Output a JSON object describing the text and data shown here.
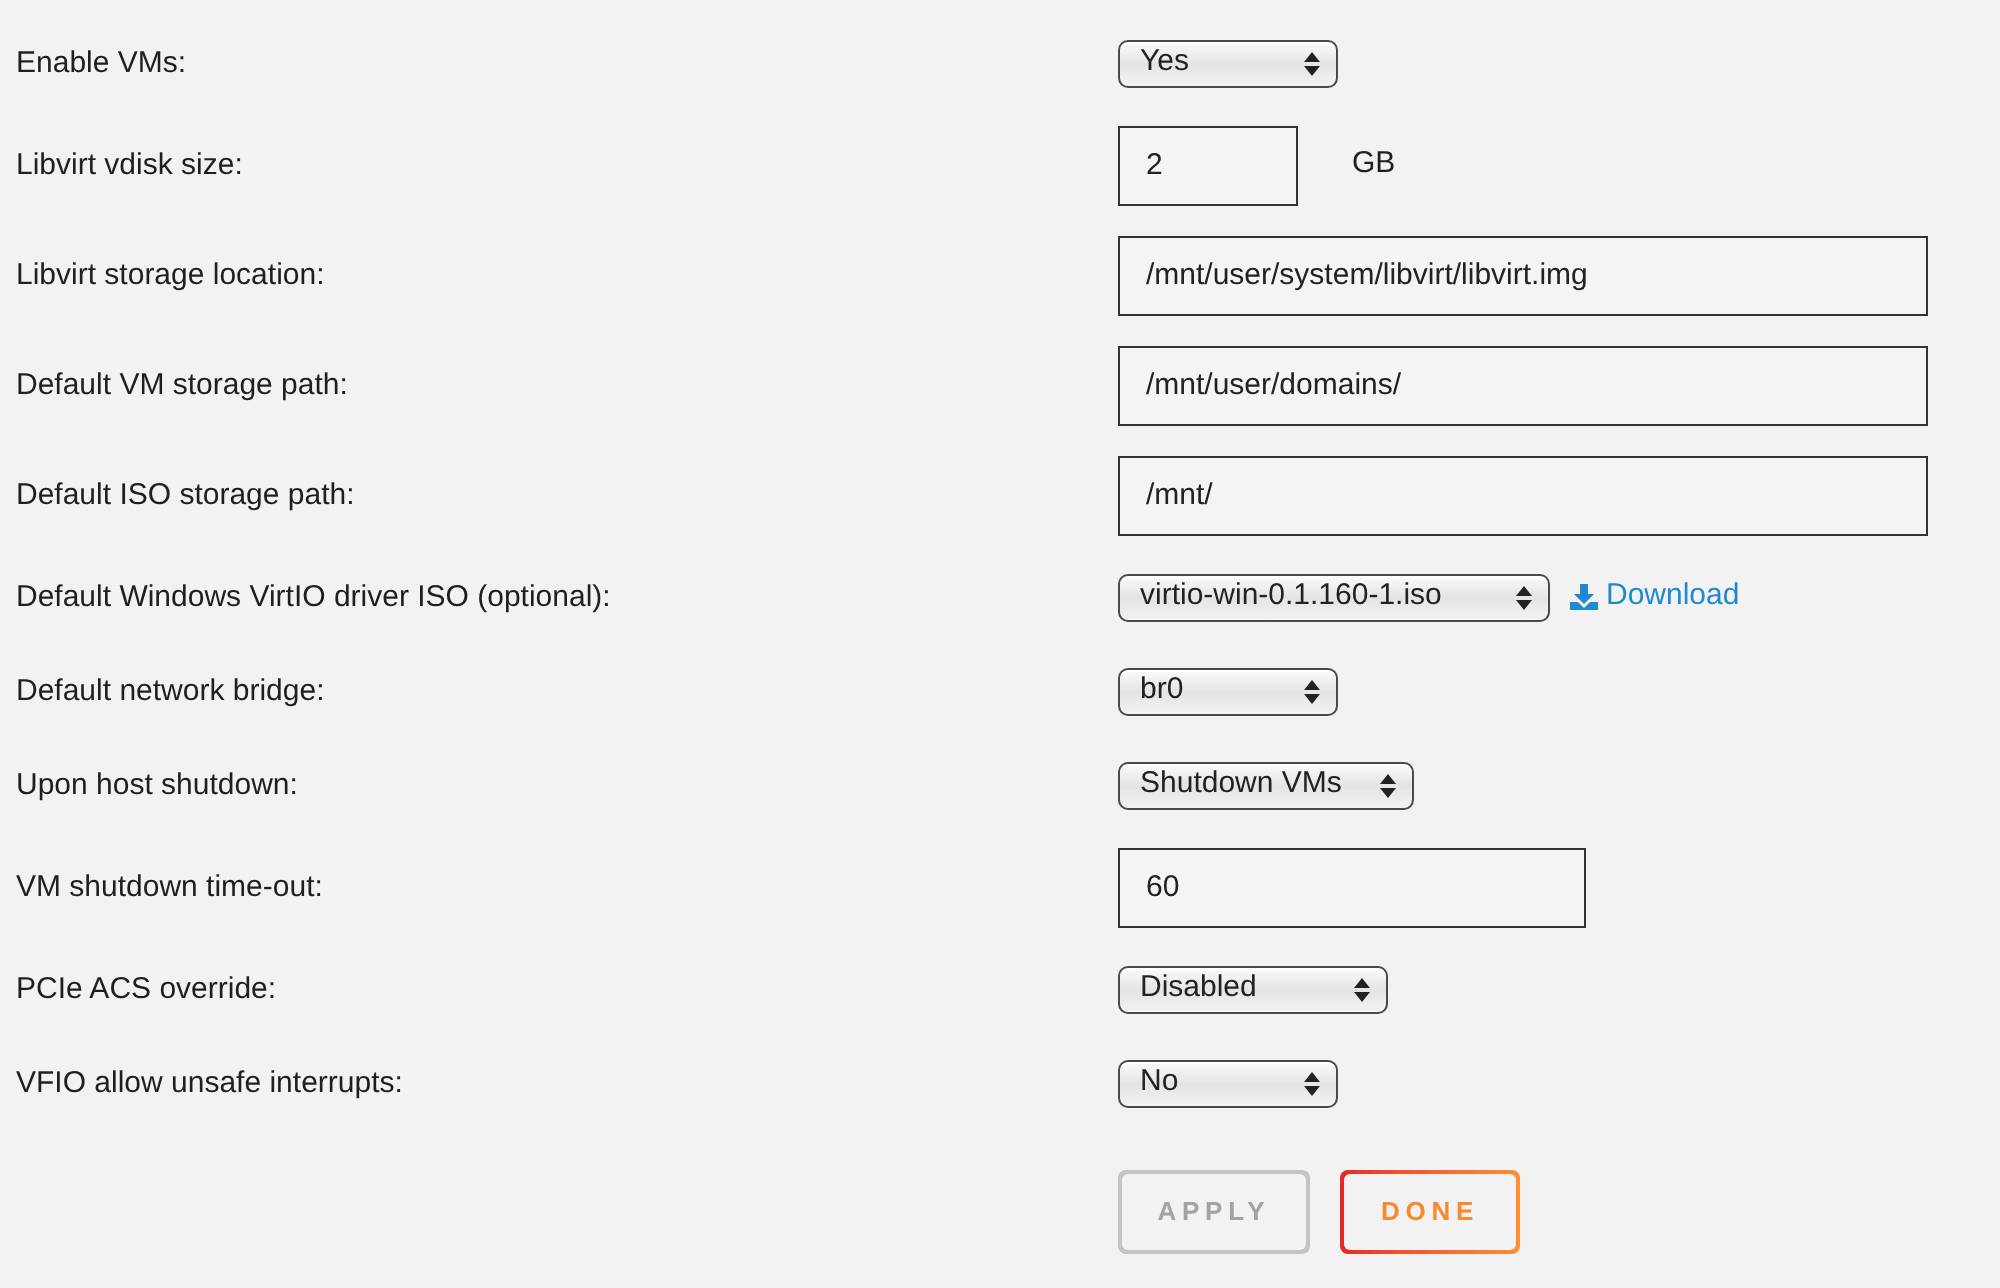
{
  "rows": [
    {
      "label": "Enable VMs:",
      "kind": "select",
      "value": "Yes"
    },
    {
      "label": "Libvirt vdisk size:",
      "kind": "input",
      "value": "2",
      "unit": "GB"
    },
    {
      "label": "Libvirt storage location:",
      "kind": "input",
      "value": "/mnt/user/system/libvirt/libvirt.img"
    },
    {
      "label": "Default VM storage path:",
      "kind": "input",
      "value": "/mnt/user/domains/"
    },
    {
      "label": "Default ISO storage path:",
      "kind": "input",
      "value": "/mnt/"
    },
    {
      "label": "Default Windows VirtIO driver ISO (optional):",
      "kind": "select",
      "value": "virtio-win-0.1.160-1.iso",
      "link": "Download"
    },
    {
      "label": "Default network bridge:",
      "kind": "select",
      "value": "br0"
    },
    {
      "label": "Upon host shutdown:",
      "kind": "select",
      "value": "Shutdown VMs"
    },
    {
      "label": "VM shutdown time-out:",
      "kind": "input",
      "value": "60"
    },
    {
      "label": "PCIe ACS override:",
      "kind": "select",
      "value": "Disabled"
    },
    {
      "label": "VFIO allow unsafe interrupts:",
      "kind": "select",
      "value": "No"
    }
  ],
  "buttons": [
    {
      "label": "APPLY",
      "disabled": true
    },
    {
      "label": "DONE",
      "disabled": false
    }
  ]
}
